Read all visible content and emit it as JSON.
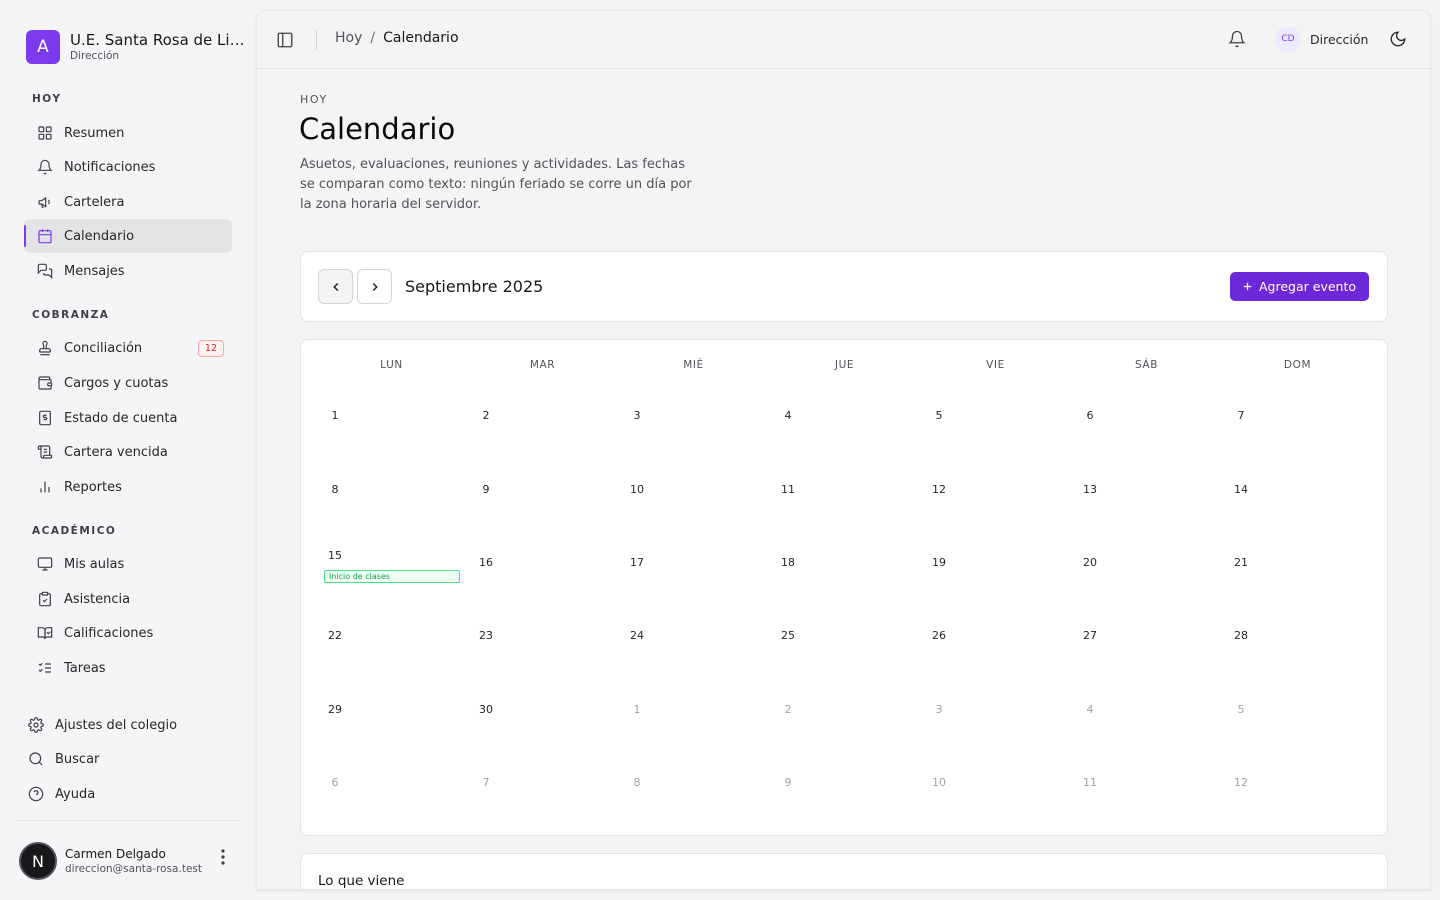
{
  "brand": {
    "logo_letter": "A",
    "name": "U.E. Santa Rosa de Li…",
    "role": "Dirección"
  },
  "sidebar": {
    "sections": [
      {
        "title": "HOY",
        "items": [
          {
            "label": "Resumen",
            "icon": "grid-icon"
          },
          {
            "label": "Notificaciones",
            "icon": "bell-icon"
          },
          {
            "label": "Cartelera",
            "icon": "megaphone-icon"
          },
          {
            "label": "Calendario",
            "icon": "calendar-icon",
            "active": true
          },
          {
            "label": "Mensajes",
            "icon": "messages-icon"
          }
        ]
      },
      {
        "title": "COBRANZA",
        "items": [
          {
            "label": "Conciliación",
            "icon": "stamp-icon",
            "badge": "12"
          },
          {
            "label": "Cargos y cuotas",
            "icon": "wallet-icon"
          },
          {
            "label": "Estado de cuenta",
            "icon": "receipt-icon"
          },
          {
            "label": "Cartera vencida",
            "icon": "scroll-icon"
          },
          {
            "label": "Reportes",
            "icon": "bar-chart-icon"
          }
        ]
      },
      {
        "title": "ACADÉMICO",
        "items": [
          {
            "label": "Mis aulas",
            "icon": "presentation-icon"
          },
          {
            "label": "Asistencia",
            "icon": "clipboard-check-icon"
          },
          {
            "label": "Calificaciones",
            "icon": "book-check-icon"
          },
          {
            "label": "Tareas",
            "icon": "list-checks-icon"
          }
        ]
      }
    ],
    "footer_items": [
      {
        "label": "Ajustes del colegio",
        "icon": "settings-icon"
      },
      {
        "label": "Buscar",
        "icon": "search-icon"
      },
      {
        "label": "Ayuda",
        "icon": "help-circle-icon"
      }
    ],
    "user": {
      "initial": "N",
      "name": "Carmen Delgado",
      "email": "direccion@santa-rosa.test"
    }
  },
  "topbar": {
    "breadcrumb": [
      "Hoy",
      "Calendario"
    ],
    "separator": "/",
    "user_initials": "CD",
    "user_label": "Dirección"
  },
  "page": {
    "eyebrow": "HOY",
    "title": "Calendario",
    "description": "Asuetos, evaluaciones, reuniones y actividades. Las fechas se comparan como texto: ningún feriado se corre un día por la zona horaria del servidor."
  },
  "calendar": {
    "month_label": "Septiembre 2025",
    "add_event_label": "Agregar evento",
    "weekdays": [
      "LUN",
      "MAR",
      "MIÉ",
      "JUE",
      "VIE",
      "SÁB",
      "DOM"
    ],
    "weeks": [
      [
        {
          "d": "1"
        },
        {
          "d": "2"
        },
        {
          "d": "3"
        },
        {
          "d": "4"
        },
        {
          "d": "5"
        },
        {
          "d": "6"
        },
        {
          "d": "7"
        }
      ],
      [
        {
          "d": "8"
        },
        {
          "d": "9"
        },
        {
          "d": "10"
        },
        {
          "d": "11"
        },
        {
          "d": "12"
        },
        {
          "d": "13"
        },
        {
          "d": "14"
        }
      ],
      [
        {
          "d": "15",
          "event": "Inicio de clases"
        },
        {
          "d": "16"
        },
        {
          "d": "17"
        },
        {
          "d": "18"
        },
        {
          "d": "19"
        },
        {
          "d": "20"
        },
        {
          "d": "21"
        }
      ],
      [
        {
          "d": "22"
        },
        {
          "d": "23"
        },
        {
          "d": "24"
        },
        {
          "d": "25"
        },
        {
          "d": "26"
        },
        {
          "d": "27"
        },
        {
          "d": "28"
        }
      ],
      [
        {
          "d": "29"
        },
        {
          "d": "30"
        },
        {
          "d": "1",
          "muted": true
        },
        {
          "d": "2",
          "muted": true
        },
        {
          "d": "3",
          "muted": true
        },
        {
          "d": "4",
          "muted": true
        },
        {
          "d": "5",
          "muted": true
        }
      ],
      [
        {
          "d": "6",
          "muted": true
        },
        {
          "d": "7",
          "muted": true
        },
        {
          "d": "8",
          "muted": true
        },
        {
          "d": "9",
          "muted": true
        },
        {
          "d": "10",
          "muted": true
        },
        {
          "d": "11",
          "muted": true
        },
        {
          "d": "12",
          "muted": true
        }
      ]
    ]
  },
  "upcoming": {
    "title": "Lo que viene"
  },
  "colors": {
    "accent": "#7c3aed",
    "event_border": "#4ade80",
    "badge": "#dc2626"
  }
}
